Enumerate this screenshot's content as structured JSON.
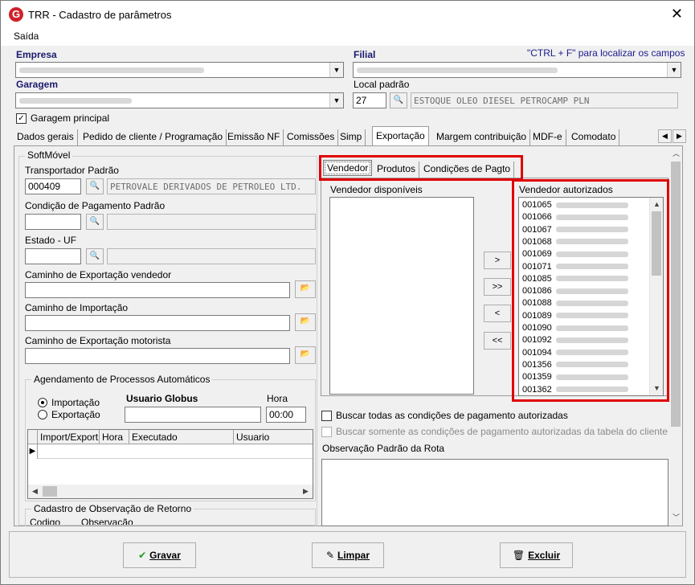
{
  "window": {
    "title": "TRR - Cadastro de parâmetros",
    "close_glyph": "✕"
  },
  "menu": {
    "items": [
      "Saída"
    ]
  },
  "header": {
    "empresa_label": "Empresa",
    "filial_label": "Filial",
    "hint": "\"CTRL + F\" para localizar os campos",
    "garagem_label": "Garagem",
    "local_padrao_label": "Local padrão",
    "local_padrao_code": "27",
    "local_padrao_desc": "ESTOQUE OLEO DIESEL PETROCAMP PLN",
    "garagem_principal_label": "Garagem principal",
    "garagem_principal_checked": true
  },
  "tabs": [
    "Dados gerais",
    "Pedido de cliente / Programação",
    "Emissão NF",
    "Comissões",
    "Simp",
    "Exportação",
    "Margem contribuição",
    "MDF-e",
    "Comodato"
  ],
  "active_tab": "Exportação",
  "softmovel": {
    "group_title": "SoftMóvel",
    "transportador_label": "Transportador Padrão",
    "transportador_code": "000409",
    "transportador_name": "PETROVALE DERIVADOS DE PETROLEO LTD.",
    "condicao_label": "Condição de Pagamento Padrão",
    "estado_label": "Estado - UF",
    "caminho_vendedor_label": "Caminho de Exportação vendedor",
    "caminho_importacao_label": "Caminho de Importação",
    "caminho_motorista_label": "Caminho de Exportação motorista"
  },
  "agendamento": {
    "group_title": "Agendamento de Processos Automáticos",
    "radio_importacao": "Importação",
    "radio_exportacao": "Exportação",
    "usuario_label": "Usuario Globus",
    "hora_label": "Hora",
    "hora_value": "00:00",
    "grid_headers": [
      "Import/Export",
      "Hora",
      "Executado",
      "Usuario"
    ]
  },
  "retorno": {
    "group_title": "Cadastro de Observação de Retorno",
    "col_codigo": "Codigo",
    "col_observacao": "Observação"
  },
  "subtabs": [
    "Vendedor",
    "Produtos",
    "Condições de Pagto"
  ],
  "active_subtab": "Vendedor",
  "vendedor": {
    "disponiveis_label": "Vendedor disponíveis",
    "autorizados_label": "Vendedor autorizados",
    "autorizados": [
      "001065",
      "001066",
      "001067",
      "001068",
      "001069",
      "001071",
      "001085",
      "001086",
      "001088",
      "001089",
      "001090",
      "001092",
      "001094",
      "001356",
      "001359",
      "001362"
    ],
    "move_buttons": [
      ">",
      ">>",
      "<",
      "<<"
    ]
  },
  "options": {
    "buscar_todas": "Buscar todas as condições de pagamento autorizadas",
    "buscar_somente": "Buscar somente as condições de pagamento autorizadas da tabela do cliente",
    "observacao_label": "Observação Padrão da Rota"
  },
  "footer": {
    "gravar": "Gravar",
    "limpar": "Limpar",
    "excluir": "Excluir"
  },
  "colors": {
    "highlight": "#e00000",
    "label_blue": "#1b1b6e"
  }
}
